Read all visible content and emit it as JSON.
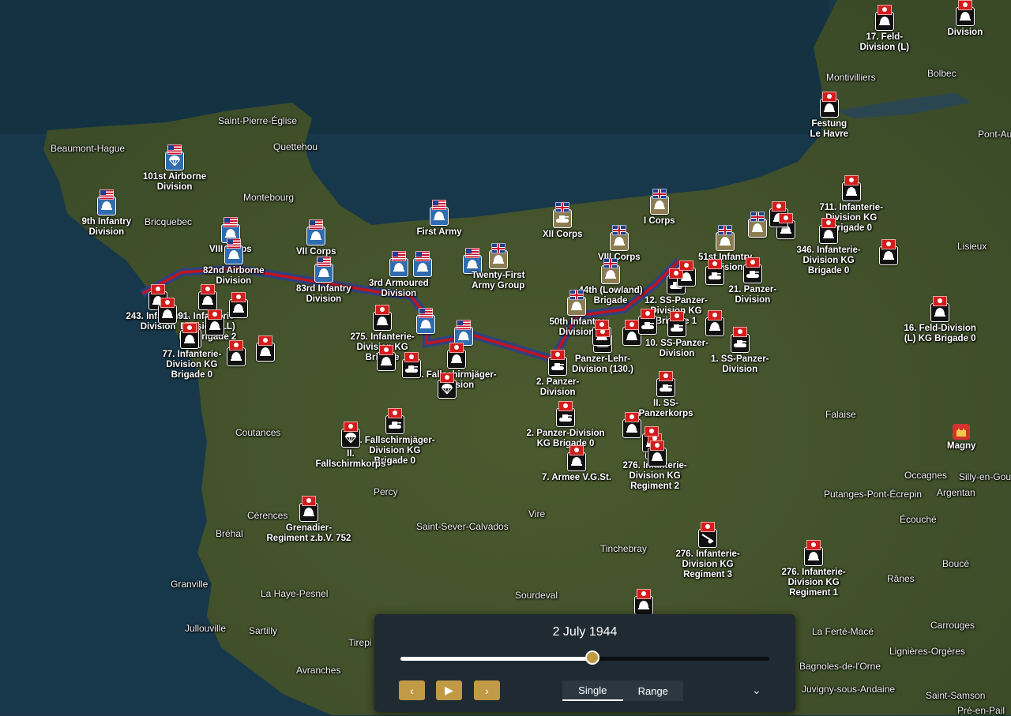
{
  "map": {
    "colors": {
      "sea": "#1a3a4a",
      "land": "#3e4f2a",
      "front_line_red": "#c0141e",
      "front_line_blue": "#2a3f8f",
      "allied_us": "#2f6cb0",
      "allied_uk": "#8b7d51",
      "axis": "#111111",
      "accent": "#c19a45"
    },
    "places": [
      {
        "name": "Saint-Pierre-Église"
      },
      {
        "name": "Beaumont-Hague"
      },
      {
        "name": "Quettehou"
      },
      {
        "name": "Montebourg"
      },
      {
        "name": "Bricquebec"
      },
      {
        "name": "Coutances"
      },
      {
        "name": "Percy"
      },
      {
        "name": "Cérences"
      },
      {
        "name": "Bréhal"
      },
      {
        "name": "Granville"
      },
      {
        "name": "La Haye-Pesnel"
      },
      {
        "name": "Sartilly"
      },
      {
        "name": "Jullouville"
      },
      {
        "name": "Avranches"
      },
      {
        "name": "Tirepi"
      },
      {
        "name": "Saint-Sever-Calvados"
      },
      {
        "name": "Vire"
      },
      {
        "name": "Sourdeval"
      },
      {
        "name": "Tinchebray"
      },
      {
        "name": "Falaise"
      },
      {
        "name": "Occagnes"
      },
      {
        "name": "Silly-en-Gou"
      },
      {
        "name": "Putanges-Pont-Écrepin"
      },
      {
        "name": "Argentan"
      },
      {
        "name": "Écouché"
      },
      {
        "name": "Rânes"
      },
      {
        "name": "Bouсé"
      },
      {
        "name": "La Ferté-Macé"
      },
      {
        "name": "Carrouges"
      },
      {
        "name": "Lignières-Orgères"
      },
      {
        "name": "Saint-Samson"
      },
      {
        "name": "Pré-en-Pail"
      },
      {
        "name": "Bagnoles-de-l'Orne"
      },
      {
        "name": "Juvigny-sous-Andaine"
      },
      {
        "name": "Bolbec"
      },
      {
        "name": "Montivilliers"
      },
      {
        "name": "Pont-Aude"
      },
      {
        "name": "Lisieux"
      }
    ],
    "city_markers": [
      {
        "name": "Magny",
        "icon": "castle-icon"
      }
    ],
    "units": [
      {
        "label": "101st Airborne\nDivision",
        "side": "us",
        "icon": "parachute-icon"
      },
      {
        "label": "9th Infantry\nDivision",
        "side": "us",
        "icon": "helmet-icon"
      },
      {
        "label": "VIII Corps",
        "side": "us",
        "icon": "helmet-icon"
      },
      {
        "label": "VII Corps",
        "side": "us",
        "icon": "helmet-icon"
      },
      {
        "label": "82nd Airborne\nDivision",
        "side": "us",
        "icon": "helmet-icon"
      },
      {
        "label": "83rd Infantry\nDivision",
        "side": "us",
        "icon": "helmet-icon"
      },
      {
        "label": "First Army",
        "side": "us",
        "icon": "helmet-icon"
      },
      {
        "label": "3rd Armoured\nDivision",
        "side": "us",
        "icon": "helmet-icon"
      },
      {
        "label": "",
        "side": "us",
        "icon": "helmet-icon"
      },
      {
        "label": "",
        "side": "us",
        "icon": "helmet-icon"
      },
      {
        "label": "",
        "side": "us",
        "icon": "helmet-icon"
      },
      {
        "label": "",
        "side": "us",
        "icon": "helmet-icon"
      },
      {
        "label": "Twenty-First\nArmy Group",
        "side": "uk",
        "icon": "helmet-icon"
      },
      {
        "label": "XII Corps",
        "side": "uk",
        "icon": "tank-icon"
      },
      {
        "label": "VIII Corps",
        "side": "uk",
        "icon": "helmet-icon"
      },
      {
        "label": "44th (Lowland)\nBrigade",
        "side": "uk",
        "icon": "helmet-icon"
      },
      {
        "label": "50th Infantry\nDivision",
        "side": "uk",
        "icon": "helmet-icon"
      },
      {
        "label": "I Corps",
        "side": "uk",
        "icon": "helmet-icon"
      },
      {
        "label": "51st Infantry\nDivision",
        "side": "uk",
        "icon": "helmet-icon"
      },
      {
        "label": "",
        "side": "uk",
        "icon": "helmet-icon"
      },
      {
        "label": "17. Feld-\nDivision (L)",
        "side": "de",
        "icon": "helmet-icon"
      },
      {
        "label": "Festung\nLe Havre",
        "side": "de",
        "icon": "helmet-icon"
      },
      {
        "label": "711. Infanterie-\nDivision KG\nBrigade 0",
        "side": "de",
        "icon": "helmet-icon"
      },
      {
        "label": "346. Infanterie-\nDivision KG\nBrigade 0",
        "side": "de",
        "icon": "helmet-icon"
      },
      {
        "label": "",
        "side": "de",
        "icon": "helmet-icon"
      },
      {
        "label": "16. Feld-Division\n(L) KG Brigade 0",
        "side": "de",
        "icon": "helmet-icon"
      },
      {
        "label": "21. Panzer-\nDivision",
        "side": "de",
        "icon": "tank-icon"
      },
      {
        "label": "12. SS-Panzer-\nDivision KG\nBrigade 1",
        "side": "de",
        "icon": "tank-icon"
      },
      {
        "label": "10. SS-Panzer-\nDivision",
        "side": "de",
        "icon": "tank-icon"
      },
      {
        "label": "1. SS-Panzer-\nDivision",
        "side": "de",
        "icon": "tank-icon"
      },
      {
        "label": "Panzer-Lehr-\nDivision (130.)",
        "side": "de",
        "icon": "tank-icon"
      },
      {
        "label": "2. Panzer-\nDivision",
        "side": "de",
        "icon": "tank-icon"
      },
      {
        "label": "II. SS-\nPanzerkorps",
        "side": "de",
        "icon": "tank-icon"
      },
      {
        "label": "2. Panzer-Division\nKG Brigade 0",
        "side": "de",
        "icon": "tank-icon"
      },
      {
        "label": "7. Armee V.G.St.",
        "side": "de",
        "icon": "helmet-icon"
      },
      {
        "label": "276. Infanterie-\nDivision KG\nRegiment 2",
        "side": "de",
        "icon": "helmet-icon"
      },
      {
        "label": "276. Infanterie-\nDivision KG\nRegiment 3",
        "side": "de",
        "icon": "artillery-icon"
      },
      {
        "label": "276. Infanterie-\nDivision KG\nRegiment 1",
        "side": "de",
        "icon": "helmet-icon"
      },
      {
        "label": "",
        "side": "de",
        "icon": "helmet-icon"
      },
      {
        "label": "3. Fallschirmjäger-\nDivision",
        "side": "de",
        "icon": "helmet-icon"
      },
      {
        "label": "",
        "side": "de",
        "icon": "parachute-icon"
      },
      {
        "label": "3. Fallschirmjäger-\nDivision KG\nBrigade 0",
        "side": "de",
        "icon": "tank-icon"
      },
      {
        "label": "II.\nFallschirmkorps",
        "side": "de",
        "icon": "parachute-icon"
      },
      {
        "label": "275. Infanterie-\nDivision KG\nBrigade",
        "side": "de",
        "icon": "helmet-icon"
      },
      {
        "label": "Grenadier-\nRegiment z.b.V. 752",
        "side": "de",
        "icon": "helmet-icon"
      },
      {
        "label": "243. Infanterie-\nDivision",
        "side": "de",
        "icon": "helmet-icon"
      },
      {
        "label": "91. Infanterie-\nDivision (LL)\nKG Brigade 2",
        "side": "de",
        "icon": "helmet-icon"
      },
      {
        "label": "77. Infanterie-\nDivision KG\nBrigade 0",
        "side": "de",
        "icon": "helmet-icon"
      },
      {
        "label": "",
        "side": "de",
        "icon": "helmet-icon"
      },
      {
        "label": "",
        "side": "de",
        "icon": "helmet-icon"
      },
      {
        "label": "",
        "side": "de",
        "icon": "helmet-icon"
      },
      {
        "label": "",
        "side": "de",
        "icon": "helmet-icon"
      },
      {
        "label": "",
        "side": "de",
        "icon": "helmet-icon"
      },
      {
        "label": "",
        "side": "de",
        "icon": "helmet-icon"
      },
      {
        "label": "",
        "side": "de",
        "icon": "tank-icon"
      },
      {
        "label": "",
        "side": "de",
        "icon": "helmet-icon"
      },
      {
        "label": "",
        "side": "de",
        "icon": "helmet-icon"
      },
      {
        "label": "",
        "side": "de",
        "icon": "helmet-icon"
      },
      {
        "label": "",
        "side": "de",
        "icon": "tank-icon"
      },
      {
        "label": "",
        "side": "de",
        "icon": "helmet-icon"
      },
      {
        "label": "",
        "side": "de",
        "icon": "helmet-icon"
      },
      {
        "label": "",
        "side": "de",
        "icon": "tank-icon"
      },
      {
        "label": "",
        "side": "de",
        "icon": "helmet-icon"
      },
      {
        "label": "",
        "side": "de",
        "icon": "helmet-icon"
      },
      {
        "label": "",
        "side": "de",
        "icon": "helmet-icon"
      },
      {
        "label": "",
        "side": "de",
        "icon": "helmet-icon"
      },
      {
        "label": "",
        "side": "de",
        "icon": "helmet-icon"
      },
      {
        "label": "Division",
        "side": "de",
        "icon": "helmet-icon"
      }
    ]
  },
  "timeline": {
    "date_label": "2 July 1944",
    "progress": 0.52,
    "prev_icon": "chevron-left-icon",
    "play_icon": "play-icon",
    "next_icon": "chevron-right-icon",
    "prev_glyph": "‹",
    "play_glyph": "▶",
    "next_glyph": "›",
    "tab_single": "Single",
    "tab_range": "Range",
    "expand_icon": "chevron-down-icon",
    "expand_glyph": "⌄"
  }
}
